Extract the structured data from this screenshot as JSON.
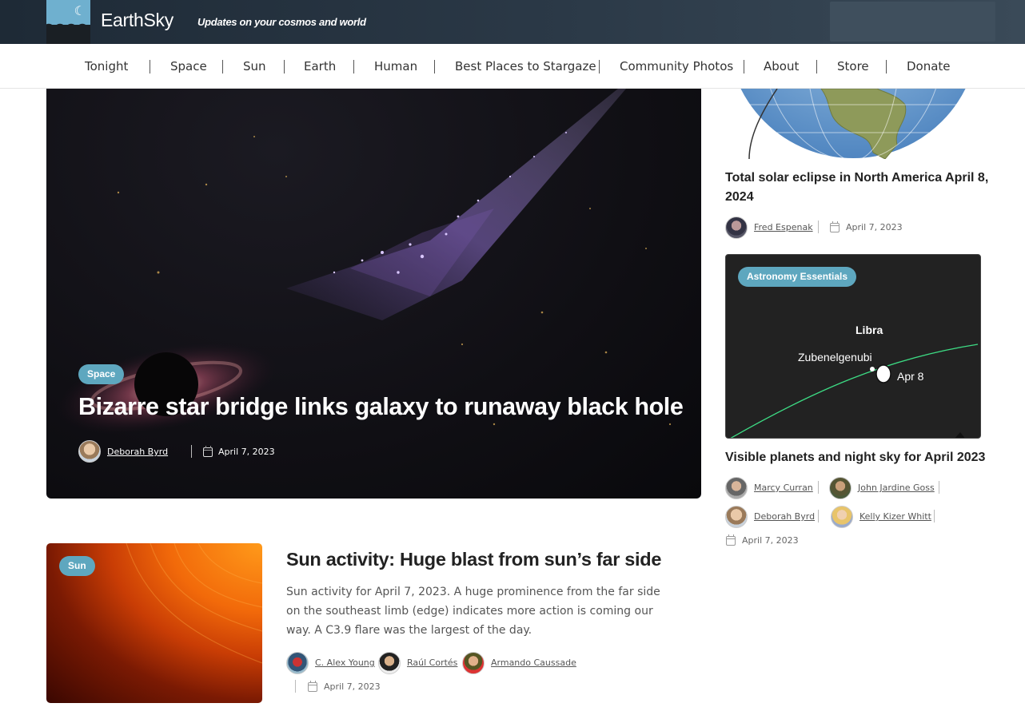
{
  "header": {
    "site_name": "EarthSky",
    "tagline": "Updates on your cosmos and world"
  },
  "nav": {
    "items": [
      {
        "label": "Tonight"
      },
      {
        "label": "Space"
      },
      {
        "label": "Sun"
      },
      {
        "label": "Earth"
      },
      {
        "label": "Human"
      },
      {
        "label": "Best Places to Stargaze"
      },
      {
        "label": "Community Photos"
      },
      {
        "label": "About"
      },
      {
        "label": "Store"
      },
      {
        "label": "Donate"
      }
    ]
  },
  "hero": {
    "category": "Space",
    "title": "Bizarre star bridge links galaxy to runaway black hole",
    "author": "Deborah Byrd",
    "date": "April 7, 2023"
  },
  "sun_article": {
    "category": "Sun",
    "title": "Sun activity: Huge blast from sun’s far side",
    "excerpt": "Sun activity for April 7, 2023. A huge prominence from the far side on the southeast limb (edge) indicates more action is coming our way. A C3.9 flare was the largest of the day.",
    "authors": [
      "C. Alex Young",
      "Raúl Cortés",
      "Armando Caussade"
    ],
    "date": "April 7, 2023"
  },
  "sidebar": {
    "eclipse": {
      "title": "Total solar eclipse in North America April 8, 2024",
      "author": "Fred Espenak",
      "date": "April 7, 2023"
    },
    "planets": {
      "category": "Astronomy Essentials",
      "chart_labels": {
        "constellation": "Libra",
        "star": "Zubenelgenubi",
        "moon_date": "Apr 8"
      },
      "title": "Visible planets and night sky for April 2023",
      "authors": [
        "Marcy Curran",
        "John Jardine Goss",
        "Deborah Byrd",
        "Kelly Kizer Whitt"
      ],
      "date": "April 7, 2023"
    }
  },
  "colors": {
    "badge": "#5ea7bf",
    "header_bg": "#243140",
    "ecliptic_line": "#3ddc84"
  }
}
